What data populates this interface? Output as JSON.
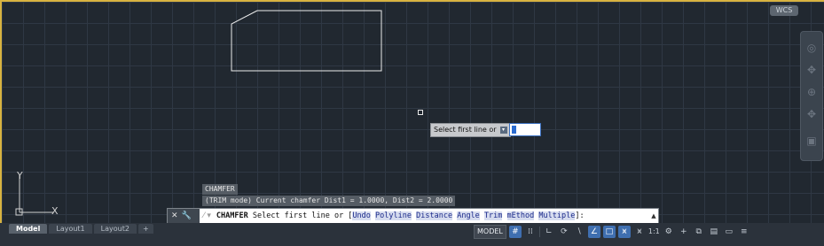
{
  "viewport": {
    "wcs_label": "WCS",
    "tooltip_text": "Select first line or",
    "ucs_x": "X",
    "ucs_y": "Y"
  },
  "command": {
    "history_1": "CHAMFER",
    "history_2": "(TRIM mode) Current chamfer Dist1 = 1.0000, Dist2 = 2.0000",
    "name": "CHAMFER",
    "prompt": "Select first line or [",
    "options": [
      "Undo",
      "Polyline",
      "Distance",
      "Angle",
      "Trim",
      "mEthod",
      "Multiple"
    ],
    "suffix": "]:"
  },
  "tabs": [
    "Model",
    "Layout1",
    "Layout2",
    "+"
  ],
  "status": {
    "model": "MODEL",
    "scale": "1:1",
    "icons": [
      "grid-icon",
      "snap-icon",
      "ortho-icon",
      "polar-icon",
      "osnap-icon",
      "otrack-icon",
      "dynamic-input-icon",
      "selection-cycling-icon",
      "annotation-visibility-icon",
      "auto-scale-icon",
      "annotation-scale-icon",
      "workspace-gear-icon",
      "plus-icon",
      "isolate-icon",
      "hardware-accel-icon",
      "fullscreen-icon",
      "customize-menu-icon"
    ]
  },
  "colors": {
    "background": "#212830",
    "grid": "#2f3844",
    "frame": "#d8b340",
    "highlight": "#3f6fb0"
  }
}
